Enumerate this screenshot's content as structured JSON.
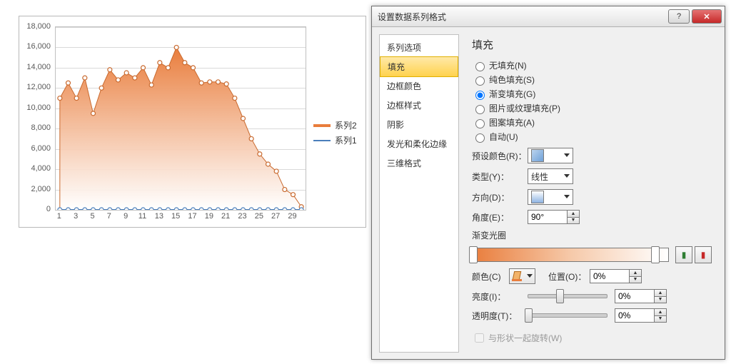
{
  "chart_data": {
    "type": "area+line",
    "x": [
      1,
      2,
      3,
      4,
      5,
      6,
      7,
      8,
      9,
      10,
      11,
      12,
      13,
      14,
      15,
      16,
      17,
      18,
      19,
      20,
      21,
      22,
      23,
      24,
      25,
      26,
      27,
      28,
      29,
      30
    ],
    "x_ticks": [
      1,
      3,
      5,
      7,
      9,
      11,
      13,
      15,
      17,
      19,
      21,
      23,
      25,
      27,
      29
    ],
    "ylim": [
      0,
      18000
    ],
    "y_ticks": [
      0,
      2000,
      4000,
      6000,
      8000,
      10000,
      12000,
      14000,
      16000,
      18000
    ],
    "y_tick_labels": [
      "0",
      "2,000",
      "4,000",
      "6,000",
      "8,000",
      "10,000",
      "12,000",
      "14,000",
      "16,000",
      "18,000"
    ],
    "series": [
      {
        "name": "系列2",
        "role": "area",
        "color": "#e97d3c",
        "values": [
          11000,
          12500,
          11000,
          13000,
          9500,
          12000,
          13800,
          12800,
          13500,
          13000,
          14000,
          12300,
          14500,
          14000,
          16000,
          14500,
          14000,
          12500,
          12600,
          12600,
          12400,
          11000,
          9000,
          7000,
          5500,
          4500,
          3800,
          2000,
          1500,
          300
        ]
      },
      {
        "name": "系列1",
        "role": "line",
        "color": "#4a7ebb",
        "values": [
          0,
          0,
          0,
          0,
          0,
          0,
          0,
          0,
          0,
          0,
          0,
          0,
          0,
          0,
          0,
          0,
          0,
          0,
          0,
          0,
          0,
          0,
          0,
          0,
          0,
          0,
          0,
          0,
          0,
          0
        ]
      }
    ],
    "legend": [
      "系列2",
      "系列1"
    ]
  },
  "dialog": {
    "title": "设置数据系列格式",
    "tabs": [
      "系列选项",
      "填充",
      "边框颜色",
      "边框样式",
      "阴影",
      "发光和柔化边缘",
      "三维格式"
    ],
    "selected_tab": "填充",
    "section_title": "填充",
    "radios": [
      {
        "label": "无填充(N)",
        "value": "none"
      },
      {
        "label": "纯色填充(S)",
        "value": "solid"
      },
      {
        "label": "渐变填充(G)",
        "value": "gradient"
      },
      {
        "label": "图片或纹理填充(P)",
        "value": "picture"
      },
      {
        "label": "图案填充(A)",
        "value": "pattern"
      },
      {
        "label": "自动(U)",
        "value": "auto"
      }
    ],
    "selected_radio": "gradient",
    "labels": {
      "preset": "预设颜色(R)：",
      "type": "类型(Y)：",
      "direction": "方向(D)：",
      "angle": "角度(E)：",
      "stops": "渐变光圈",
      "color": "颜色(C)",
      "position": "位置(O)：",
      "brightness": "亮度(I)：",
      "transparency": "透明度(T)：",
      "rotate": "与形状一起旋转(W)"
    },
    "type_value": "线性",
    "angle_value": "90°",
    "position_value": "0%",
    "brightness_value": "0%",
    "transparency_value": "0%",
    "stop_positions": [
      0,
      93
    ],
    "brightness_slider": 40,
    "transparency_slider": 0
  }
}
